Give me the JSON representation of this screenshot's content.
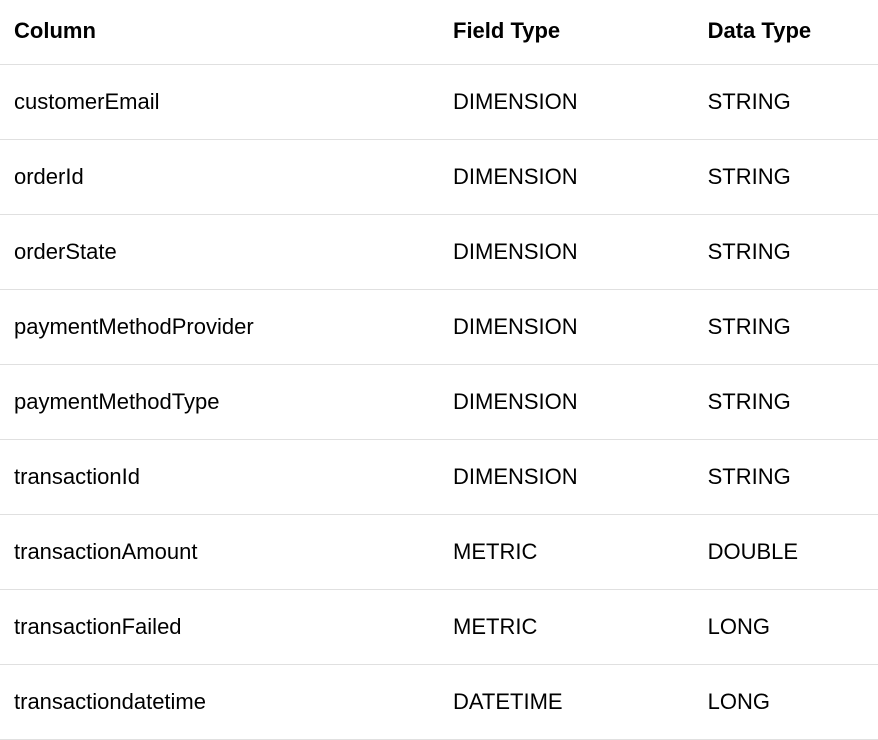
{
  "table": {
    "headers": {
      "column": "Column",
      "fieldType": "Field Type",
      "dataType": "Data Type"
    },
    "rows": [
      {
        "column": "customerEmail",
        "fieldType": "DIMENSION",
        "dataType": "STRING"
      },
      {
        "column": "orderId",
        "fieldType": "DIMENSION",
        "dataType": "STRING"
      },
      {
        "column": "orderState",
        "fieldType": "DIMENSION",
        "dataType": "STRING"
      },
      {
        "column": "paymentMethodProvider",
        "fieldType": "DIMENSION",
        "dataType": "STRING"
      },
      {
        "column": "paymentMethodType",
        "fieldType": "DIMENSION",
        "dataType": "STRING"
      },
      {
        "column": "transactionId",
        "fieldType": "DIMENSION",
        "dataType": "STRING"
      },
      {
        "column": "transactionAmount",
        "fieldType": "METRIC",
        "dataType": "DOUBLE"
      },
      {
        "column": "transactionFailed",
        "fieldType": "METRIC",
        "dataType": "LONG"
      },
      {
        "column": "transactiondatetime",
        "fieldType": "DATETIME",
        "dataType": "LONG"
      }
    ]
  }
}
